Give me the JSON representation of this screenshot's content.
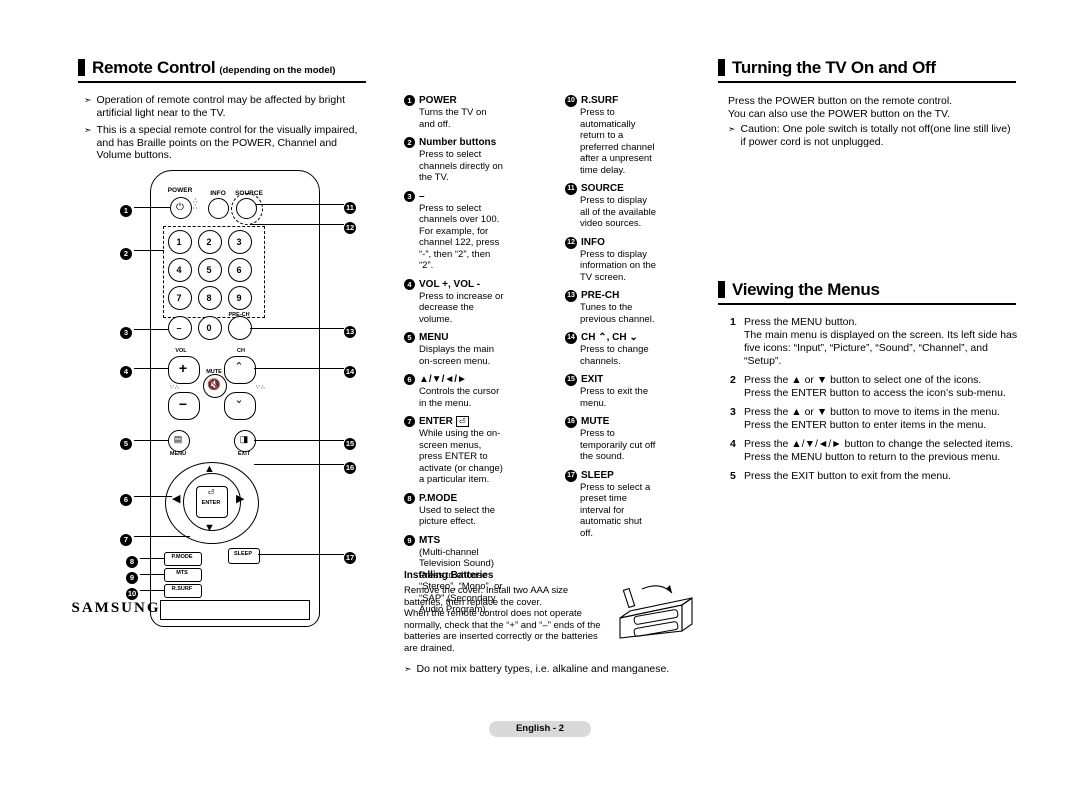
{
  "sections": {
    "remote_control": {
      "title": "Remote Control",
      "subtitle": "(depending on the model)",
      "bullets": [
        "Operation of remote control may be affected by bright artificial light near to the TV.",
        "This is a special remote control for the visually impaired, and has Braille points on the POWER, Channel and Volume buttons."
      ]
    },
    "turning_tv": {
      "title": "Turning the TV On and Off",
      "lines": [
        "Press the POWER button on the remote control.",
        "You can also use the POWER button on the TV."
      ],
      "caution": "Caution: One pole switch is totally not off(one line still live) if power cord is not unplugged."
    },
    "viewing_menus": {
      "title": "Viewing the Menus",
      "steps": [
        {
          "n": "1",
          "text": "Press the MENU button.\nThe main menu is displayed on the screen. Its left side has five icons: “Input”, “Picture”, “Sound”, “Channel”, and “Setup”."
        },
        {
          "n": "2",
          "text": "Press the ▲ or ▼ button to select one of the icons.\nPress the ENTER button to access the icon’s sub-menu."
        },
        {
          "n": "3",
          "text": "Press the ▲ or ▼ button to move to items in the menu.\nPress the ENTER button to enter items in the menu."
        },
        {
          "n": "4",
          "text": "Press the ▲/▼/◄/► button to change the selected items.\nPress the MENU button to return to the previous menu."
        },
        {
          "n": "5",
          "text": "Press the EXIT button to exit from the menu."
        }
      ]
    },
    "installing_batteries": {
      "title": "Installing Batteries",
      "body": "Remove the cover. Install two AAA size batteries, then replace the cover.\nWhen the remote control does not operate normally, check that the “+” and “–” ends of the batteries are inserted correctly or the batteries are drained.",
      "note": "Do not mix battery types, i.e. alkaline and manganese."
    }
  },
  "legend_col1": [
    {
      "n": "1",
      "title": "POWER",
      "body": "Turns the TV on and off."
    },
    {
      "n": "2",
      "title": "Number buttons",
      "body": "Press to select channels directly on the TV."
    },
    {
      "n": "3",
      "title": "–",
      "body": "Press to select channels over 100. For example, for channel 122, press “-”, then “2”, then “2”."
    },
    {
      "n": "4",
      "title": "VOL +, VOL -",
      "body": "Press to increase or decrease the volume."
    },
    {
      "n": "5",
      "title": "MENU",
      "body": "Displays the main on-screen menu."
    },
    {
      "n": "6",
      "title": "▲/▼/◄/►",
      "body": "Controls the cursor in the menu."
    },
    {
      "n": "7",
      "title": "ENTER",
      "body": "While using the on-screen menus, press ENTER to activate (or change) a particular item."
    },
    {
      "n": "8",
      "title": "P.MODE",
      "body": "Used to select the picture effect."
    },
    {
      "n": "9",
      "title": "MTS",
      "body": "(Multi-channel Television Sound)\nPress to choose “Stereo”, “Mono”, or “SAP” (Secondary Audio Program)."
    }
  ],
  "legend_col2": [
    {
      "n": "10",
      "title": "R.SURF",
      "body": "Press to automatically return to a preferred channel after a unpresent time delay."
    },
    {
      "n": "11",
      "title": "SOURCE",
      "body": "Press to display all of the available video sources."
    },
    {
      "n": "12",
      "title": "INFO",
      "body": "Press to display information on the TV screen."
    },
    {
      "n": "13",
      "title": "PRE-CH",
      "body": "Tunes to the previous channel."
    },
    {
      "n": "14",
      "title": "CH ⌃, CH ⌄",
      "body": "Press to change channels."
    },
    {
      "n": "15",
      "title": "EXIT",
      "body": "Press to exit the menu."
    },
    {
      "n": "16",
      "title": "MUTE",
      "body": "Press to temporarily cut off the sound."
    },
    {
      "n": "17",
      "title": "SLEEP",
      "body": "Press to select a preset time interval for automatic shut off."
    }
  ],
  "remote": {
    "brand": "SAMSUNG",
    "top_labels": [
      "POWER",
      "INFO",
      "SOURCE"
    ],
    "numbers": [
      "1",
      "2",
      "3",
      "4",
      "5",
      "6",
      "7",
      "8",
      "9",
      "0"
    ],
    "minus_label": "–",
    "prech_label": "PRE-CH",
    "vol_label": "VOL",
    "ch_label": "CH",
    "mute_label": "MUTE",
    "menu_label": "MENU",
    "exit_label": "EXIT",
    "enter_label": "ENTER",
    "pmode_label": "P.MODE",
    "mts_label": "MTS",
    "rsurf_label": "R.SURF",
    "sleep_label": "SLEEP",
    "callouts_left": [
      "1",
      "2",
      "3",
      "4",
      "5",
      "6",
      "7",
      "8",
      "9",
      "10"
    ],
    "callouts_right": [
      "11",
      "12",
      "13",
      "14",
      "15",
      "16",
      "17"
    ]
  },
  "footer": {
    "page_label": "English - 2"
  }
}
